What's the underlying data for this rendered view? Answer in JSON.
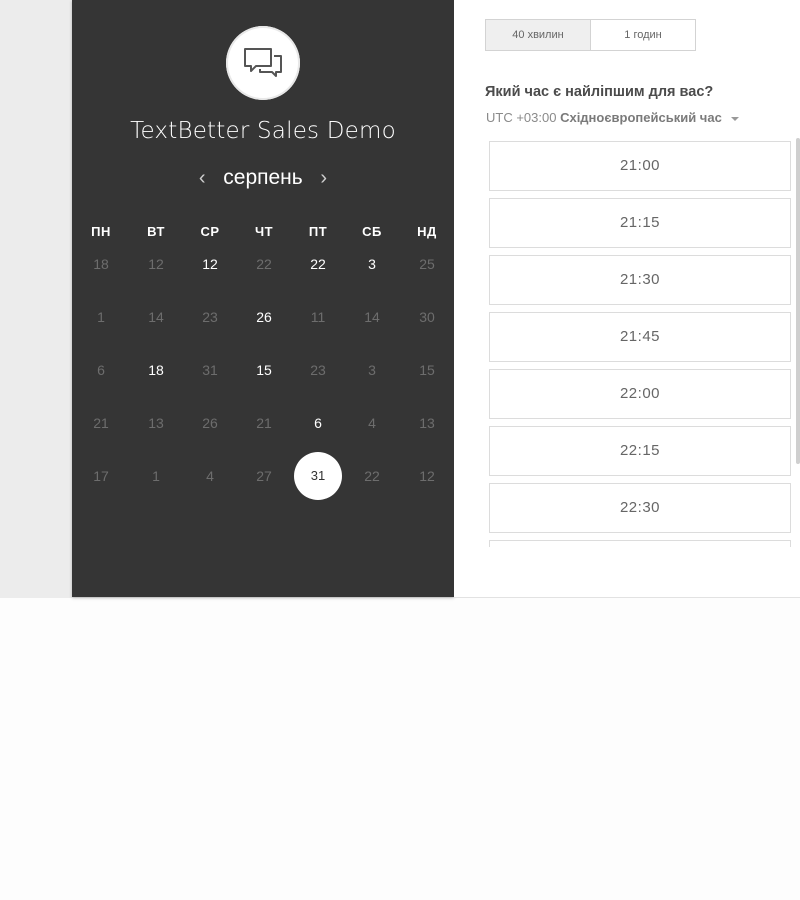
{
  "brand": {
    "name": "TextBetter Sales Demo",
    "logo_icon": "chat-bubbles-icon"
  },
  "calendar": {
    "month": "серпень",
    "prev_icon": "‹",
    "next_icon": "›",
    "weekdays": [
      "ПН",
      "ВТ",
      "СР",
      "ЧТ",
      "ПТ",
      "СБ",
      "НД"
    ],
    "weeks": [
      [
        {
          "d": "18",
          "a": false
        },
        {
          "d": "12",
          "a": false
        },
        {
          "d": "12",
          "a": true
        },
        {
          "d": "22",
          "a": false
        },
        {
          "d": "22",
          "a": true
        },
        {
          "d": "3",
          "a": true
        },
        {
          "d": "25",
          "a": false
        }
      ],
      [
        {
          "d": "1",
          "a": false
        },
        {
          "d": "14",
          "a": false
        },
        {
          "d": "23",
          "a": false
        },
        {
          "d": "26",
          "a": true
        },
        {
          "d": "11",
          "a": false
        },
        {
          "d": "14",
          "a": false
        },
        {
          "d": "30",
          "a": false
        }
      ],
      [
        {
          "d": "6",
          "a": false
        },
        {
          "d": "18",
          "a": true
        },
        {
          "d": "31",
          "a": false
        },
        {
          "d": "15",
          "a": true
        },
        {
          "d": "23",
          "a": false
        },
        {
          "d": "3",
          "a": false
        },
        {
          "d": "15",
          "a": false
        }
      ],
      [
        {
          "d": "21",
          "a": false
        },
        {
          "d": "13",
          "a": false
        },
        {
          "d": "26",
          "a": false
        },
        {
          "d": "21",
          "a": false
        },
        {
          "d": "6",
          "a": true
        },
        {
          "d": "4",
          "a": false
        },
        {
          "d": "13",
          "a": false
        }
      ],
      [
        {
          "d": "17",
          "a": false
        },
        {
          "d": "1",
          "a": false
        },
        {
          "d": "4",
          "a": false
        },
        {
          "d": "27",
          "a": false
        },
        {
          "d": "31",
          "a": true,
          "selected": true
        },
        {
          "d": "22",
          "a": false
        },
        {
          "d": "12",
          "a": false
        }
      ]
    ]
  },
  "duration": {
    "options": [
      "40 хвилин",
      "1 годин"
    ],
    "selected_index": 0
  },
  "question": "Який час є найліпшим для вас?",
  "timezone": {
    "offset": "UTC +03:00",
    "name": "Східноєвропейський час"
  },
  "slots": [
    "21:00",
    "21:15",
    "21:30",
    "21:45",
    "22:00",
    "22:15",
    "22:30",
    ""
  ]
}
